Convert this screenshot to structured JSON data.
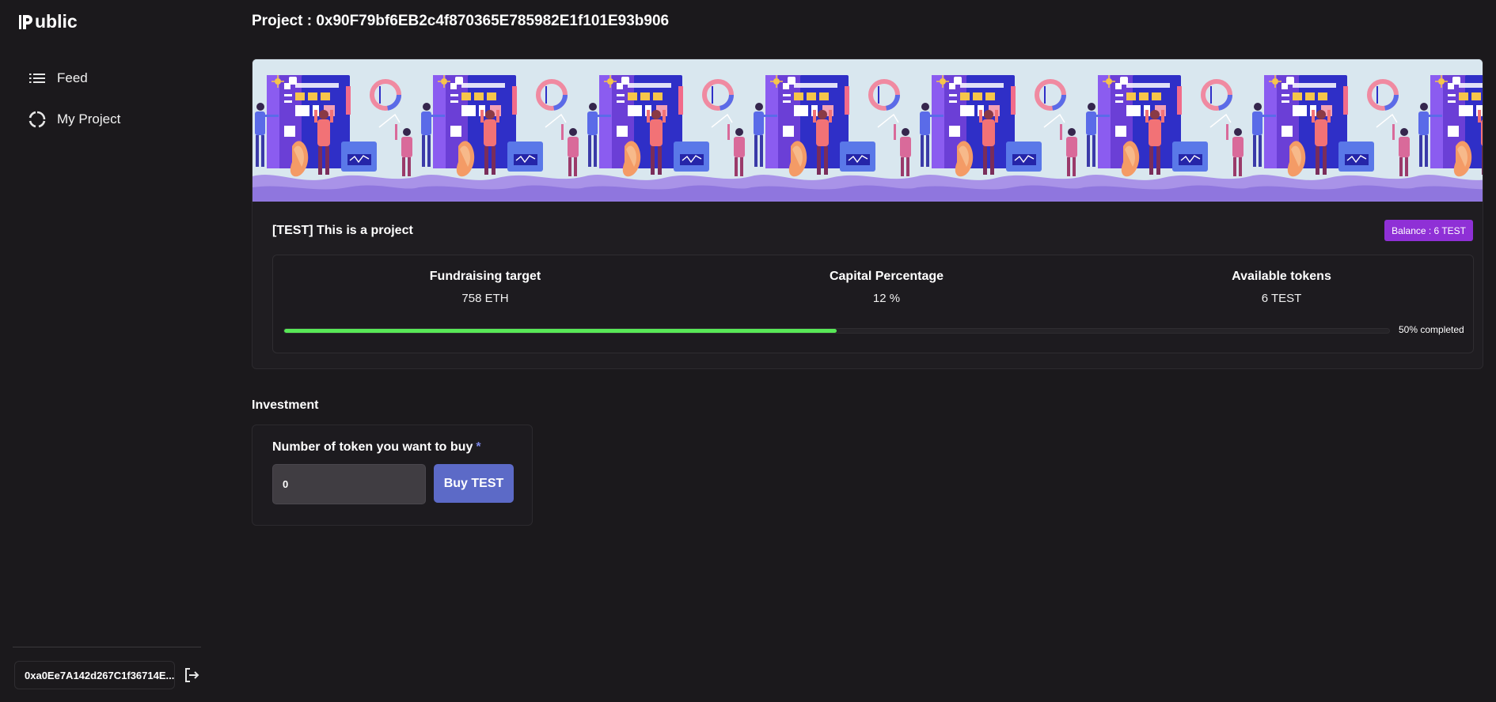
{
  "brand": {
    "logo_text": "ublic"
  },
  "sidebar": {
    "items": [
      {
        "label": "Feed",
        "icon": "list-icon"
      },
      {
        "label": "My Project",
        "icon": "circle-arc-icon"
      }
    ],
    "wallet_address": "0xa0Ee7A142d267C1f36714E..."
  },
  "header": {
    "prefix": "Project : ",
    "address": "0x90F79bf6EB2c4f870365E785982E1f101E93b906"
  },
  "project": {
    "name": "[TEST] This is a project",
    "balance_badge": "Balance : 6 TEST",
    "stats": [
      {
        "label": "Fundraising target",
        "value": "758 ETH"
      },
      {
        "label": "Capital Percentage",
        "value": "12 %"
      },
      {
        "label": "Available tokens",
        "value": "6 TEST"
      }
    ],
    "progress": {
      "percent": 50,
      "label": "50% completed"
    }
  },
  "investment": {
    "section_title": "Investment",
    "field_label": "Number of token you want to buy",
    "required_mark": "*",
    "input_placeholder": "0",
    "button_label": "Buy TEST"
  },
  "colors": {
    "background": "#1b191c",
    "accent_button": "#5c6ac7",
    "badge": "#8f30d6",
    "progress": "#58e857"
  }
}
